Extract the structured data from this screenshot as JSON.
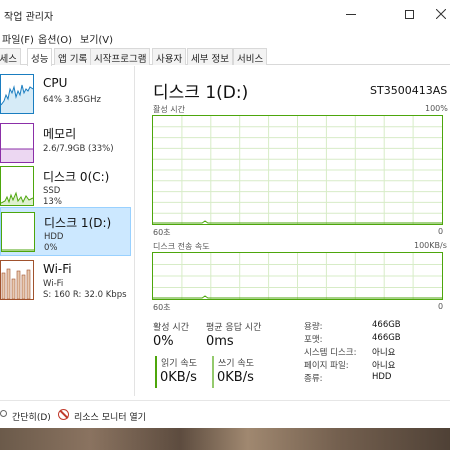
{
  "window": {
    "title": "작업 관리자"
  },
  "menu": [
    "파일(F)",
    "옵션(O)",
    "보기(V)"
  ],
  "tabs": [
    {
      "label": "프로세스",
      "active": false
    },
    {
      "label": "성능",
      "active": true
    },
    {
      "label": "앱 기록",
      "active": false
    },
    {
      "label": "시작프로그램",
      "active": false
    },
    {
      "label": "사용자",
      "active": false
    },
    {
      "label": "세부 정보",
      "active": false
    },
    {
      "label": "서비스",
      "active": false
    }
  ],
  "sidebar": {
    "items": [
      {
        "name": "CPU",
        "lines": [
          "64% 3.85GHz"
        ],
        "color": "#1a7dc0",
        "selected": false
      },
      {
        "name": "메모리",
        "lines": [
          "2.6/7.9GB (33%)"
        ],
        "color": "#8b2fa8",
        "selected": false
      },
      {
        "name": "디스크 0(C:)",
        "lines": [
          "SSD",
          "13%"
        ],
        "color": "#4da60c",
        "selected": false
      },
      {
        "name": "디스크 1(D:)",
        "lines": [
          "HDD",
          "0%"
        ],
        "color": "#4da60c",
        "selected": true
      },
      {
        "name": "Wi-Fi",
        "lines": [
          "Wi-Fi",
          "S: 160  R: 32.0 Kbps"
        ],
        "color": "#a0522d",
        "selected": false
      }
    ]
  },
  "main": {
    "title": "디스크 1(D:)",
    "model": "ST3500413AS",
    "active_time": {
      "label": "활성 시간",
      "max": "100%",
      "x_left": "60초",
      "x_right": "0",
      "value_pct": 0
    },
    "transfer_rate": {
      "label": "디스크 전송 속도",
      "max": "100KB/s",
      "x_left": "60초",
      "x_right": "0",
      "value_kbps": 0
    },
    "stats": {
      "active_time_label": "활성 시간",
      "active_time_value": "0%",
      "response_label": "평균 응답 시간",
      "response_value": "0ms",
      "read_label": "읽기 속도",
      "read_value": "0KB/s",
      "write_label": "쓰기 속도",
      "write_value": "0KB/s"
    },
    "properties": [
      {
        "label": "용량:",
        "value": "466GB"
      },
      {
        "label": "포맷:",
        "value": "466GB"
      },
      {
        "label": "시스템 디스크:",
        "value": "아니요"
      },
      {
        "label": "페이지 파일:",
        "value": "아니요"
      },
      {
        "label": "종류:",
        "value": "HDD"
      }
    ]
  },
  "footer": {
    "collapse_label": "간단히(D)",
    "resource_monitor_label": "리소스 모니터 열기"
  },
  "colors": {
    "disk": "#4da60c",
    "cpu": "#1a7dc0",
    "memory": "#8b2fa8",
    "wifi": "#a0522d",
    "selected_bg": "#cce8ff",
    "read_bar": "#4da60c",
    "write_bar": "#4da60c"
  },
  "icons": {
    "collapse": "chevron-up-icon",
    "resource_monitor": "resource-monitor-icon",
    "minimize": "minimize-icon",
    "maximize": "maximize-icon",
    "close": "close-icon"
  }
}
